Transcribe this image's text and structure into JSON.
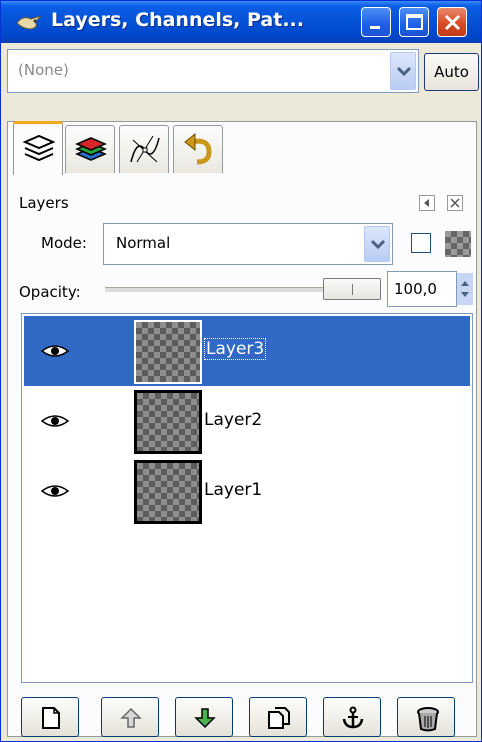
{
  "window": {
    "title": "Layers, Channels, Pat...",
    "buttons": {
      "minimize": "minimize-icon",
      "maximize": "maximize-icon",
      "close": "close-icon"
    }
  },
  "image_menu": {
    "selected": "(None)",
    "auto_label": "Auto"
  },
  "tabs": [
    {
      "icon": "layers-icon",
      "active": true
    },
    {
      "icon": "channels-icon",
      "active": false
    },
    {
      "icon": "paths-icon",
      "active": false
    },
    {
      "icon": "undo-history-icon",
      "active": false
    }
  ],
  "panel": {
    "title": "Layers",
    "mode_label": "Mode:",
    "mode_value": "Normal",
    "opacity_label": "Opacity:",
    "opacity_value": "100,0",
    "opacity_level": 1.0
  },
  "layers": [
    {
      "name": "Layer3",
      "visible": true,
      "selected": true
    },
    {
      "name": "Layer2",
      "visible": true,
      "selected": false
    },
    {
      "name": "Layer1",
      "visible": true,
      "selected": false
    }
  ],
  "toolbar": [
    {
      "icon": "new-layer-icon"
    },
    {
      "icon": "raise-layer-icon"
    },
    {
      "icon": "lower-layer-icon"
    },
    {
      "icon": "duplicate-layer-icon"
    },
    {
      "icon": "anchor-layer-icon"
    },
    {
      "icon": "delete-layer-icon"
    }
  ],
  "colors": {
    "titlebar": "#0452d6",
    "selection": "#316ac5",
    "active_tab": "#f3a81c"
  }
}
